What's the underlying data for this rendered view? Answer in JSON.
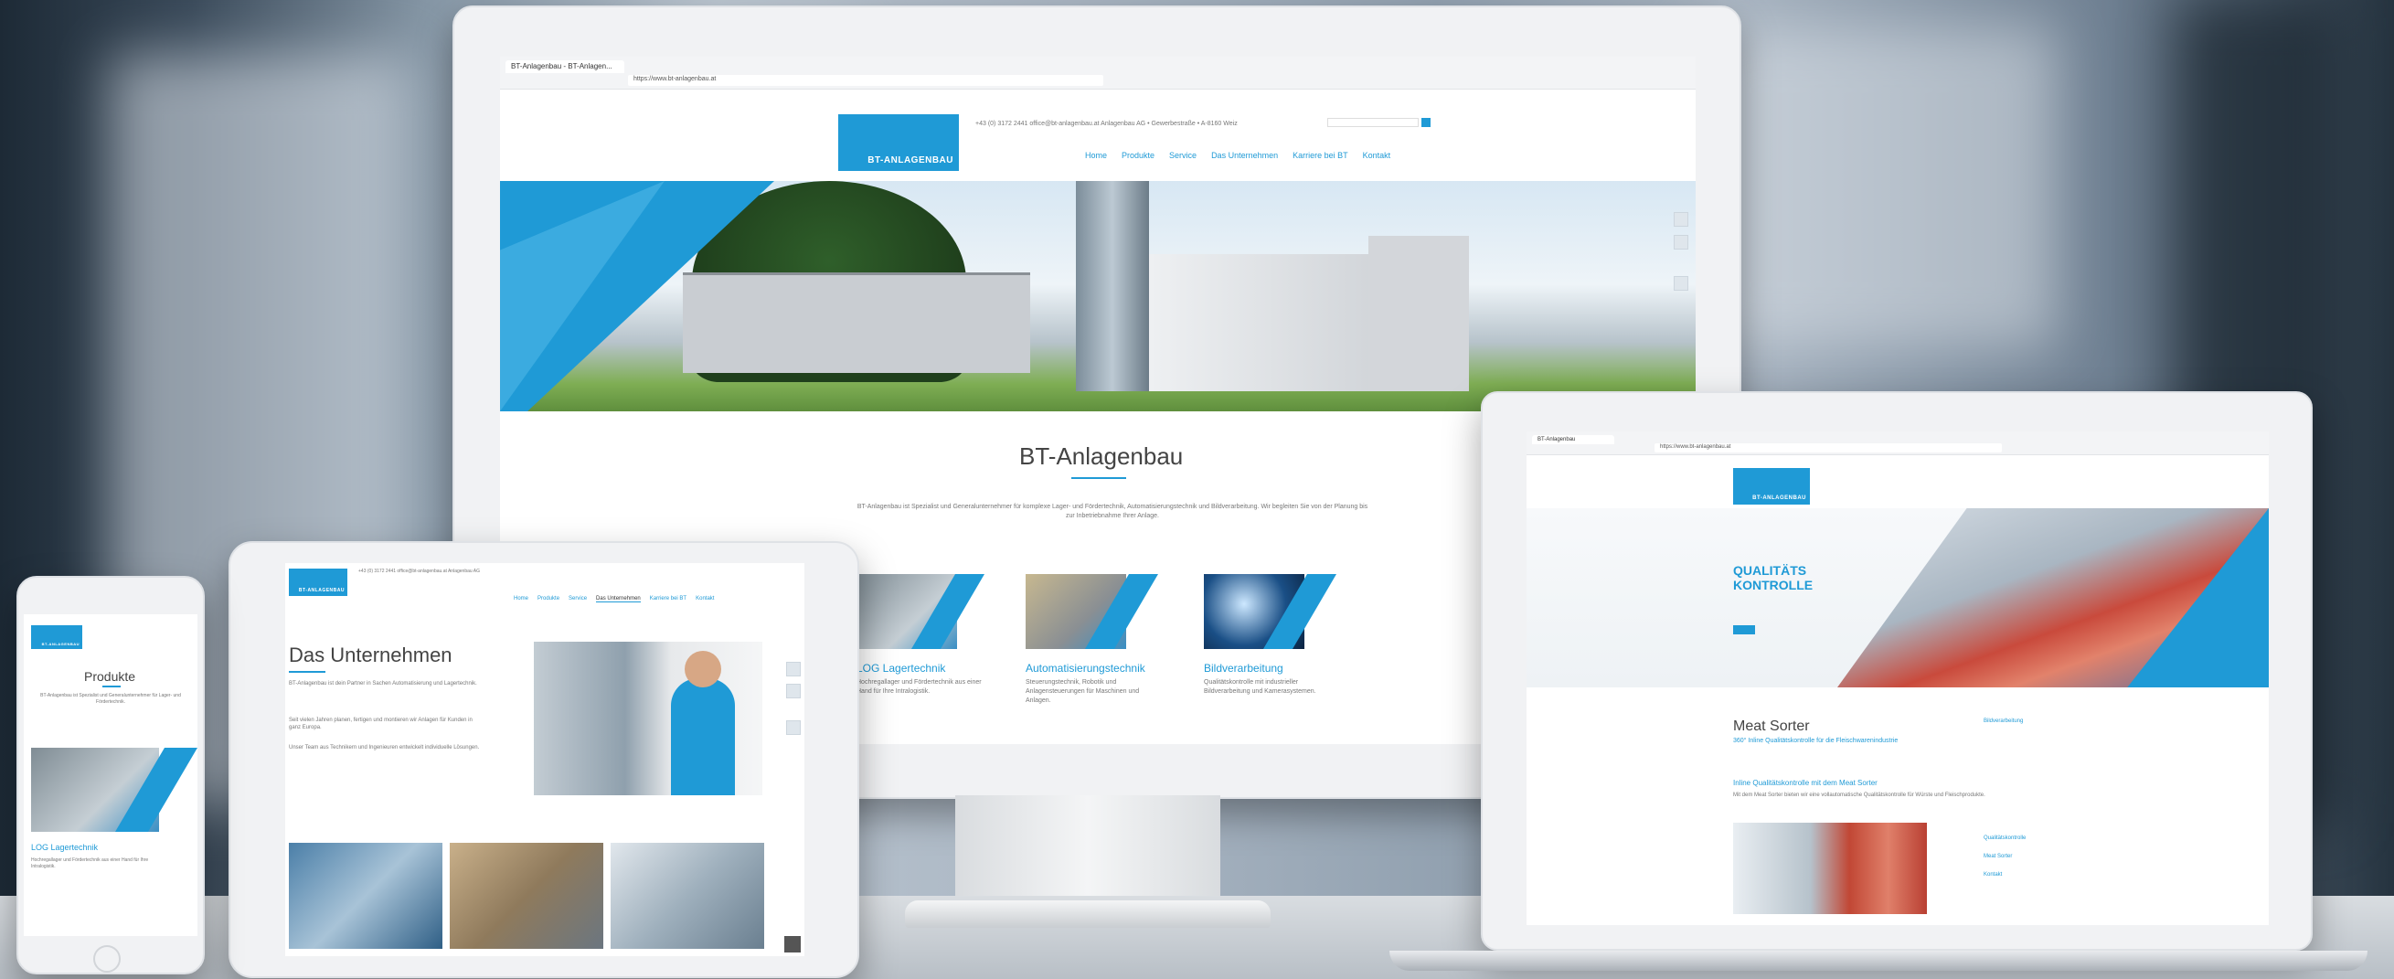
{
  "monitor": {
    "tab_title": "BT-Anlagenbau - BT-Anlagen...",
    "url": "https://www.bt-anlagenbau.at",
    "logo_text": "BT-ANLAGENBAU",
    "top_info": "+43 (0) 3172 2441    office@bt-anlagenbau.at    Anlagenbau AG • Gewerbestraße • A-8160 Weiz",
    "nav": [
      "Home",
      "Produkte",
      "Service",
      "Das Unternehmen",
      "Karriere bei BT",
      "Kontakt"
    ],
    "heading": "BT-Anlagenbau",
    "intro": "BT-Anlagenbau ist Spezialist und Generalunternehmer für komplexe Lager- und Fördertechnik, Automatisierungstechnik und Bildverarbeitung. Wir begleiten Sie von der Planung bis zur Inbetriebnahme Ihrer Anlage.",
    "cards": [
      {
        "title": "LOG Lagertechnik",
        "text": "Hochregallager und Fördertechnik aus einer Hand für Ihre Intralogistik."
      },
      {
        "title": "Automatisierungstechnik",
        "text": "Steuerungstechnik, Robotik und Anlagensteuerungen für Maschinen und Anlagen."
      },
      {
        "title": "Bildverarbeitung",
        "text": "Qualitätskontrolle mit industrieller Bildverarbeitung und Kamerasystemen."
      }
    ]
  },
  "tablet": {
    "top_info": "+43 (0) 3172 2441    office@bt-anlagenbau.at    Anlagenbau AG",
    "nav": [
      "Home",
      "Produkte",
      "Service",
      "Das Unternehmen",
      "Karriere bei BT",
      "Kontakt"
    ],
    "heading": "Das Unternehmen",
    "p1": "BT-Anlagenbau ist dein Partner in Sachen Automatisierung und Lagertechnik.",
    "p2": "Seit vielen Jahren planen, fertigen und montieren wir Anlagen für Kunden in ganz Europa.",
    "p3": "Unser Team aus Technikern und Ingenieuren entwickelt individuelle Lösungen."
  },
  "phone": {
    "heading": "Produkte",
    "text": "BT-Anlagenbau ist Spezialist und Generalunternehmer für Lager- und Fördertechnik.",
    "product_title": "LOG Lagertechnik",
    "product_text": "Hochregallager und Fördertechnik aus einer Hand für Ihre Intralogistik."
  },
  "laptop": {
    "tab_title": "BT-Anlagenbau",
    "url": "https://www.bt-anlagenbau.at",
    "hero_title_1": "QUALITÄTS",
    "hero_title_2": "KONTROLLE",
    "page_heading": "Meat Sorter",
    "subheading": "360° Inline Qualitätskontrolle für die Fleischwarenindustrie",
    "section_title": "Inline Qualitätskontrolle mit dem Meat Sorter",
    "body": "Mit dem Meat Sorter bieten wir eine vollautomatische Qualitätskontrolle für Würste und Fleischprodukte.",
    "sidebar": [
      "Bildverarbeitung",
      "Qualitätskontrolle",
      "Meat Sorter",
      "Kontakt"
    ]
  },
  "colors": {
    "brand": "#1f9ad6",
    "brand_dark": "#0d6fb0"
  }
}
